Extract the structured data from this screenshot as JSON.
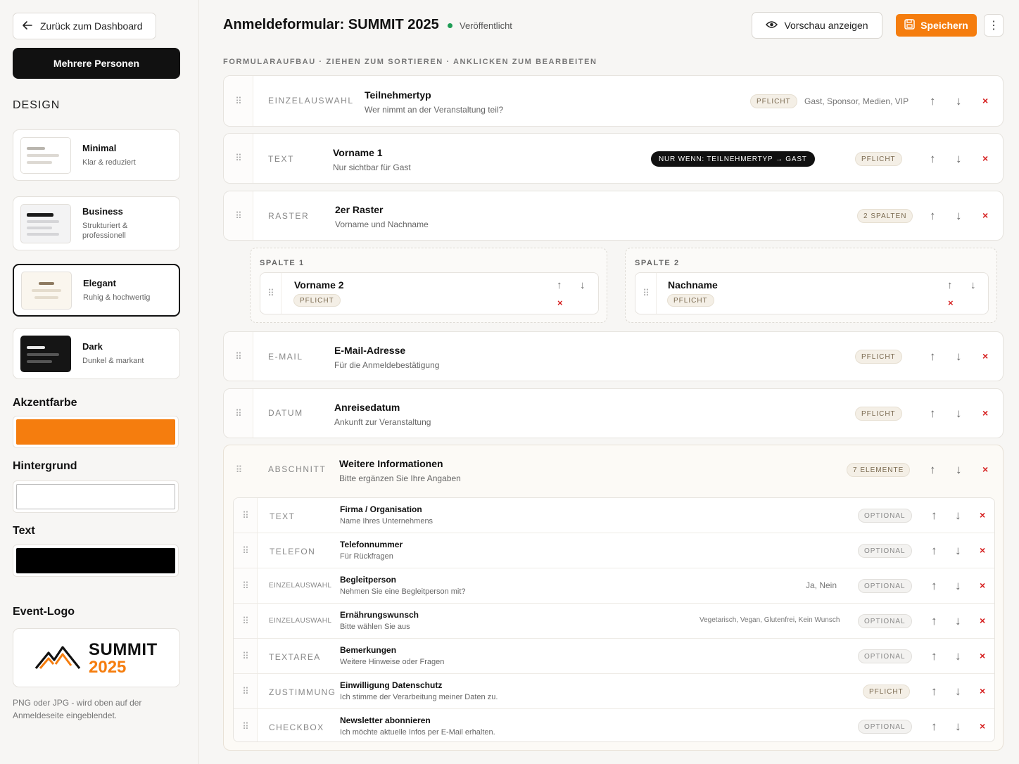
{
  "sidebar": {
    "back_label": "Zurück zum Dashboard",
    "multi_label": "Mehrere Personen",
    "design_heading": "DESIGN",
    "themes": [
      {
        "title": "Minimal",
        "subtitle": "Klar & reduziert"
      },
      {
        "title": "Business",
        "subtitle": "Strukturiert & professionell"
      },
      {
        "title": "Elegant",
        "subtitle": "Ruhig & hochwertig"
      },
      {
        "title": "Dark",
        "subtitle": "Dunkel & markant"
      }
    ],
    "selected_theme": "Elegant",
    "accent_label": "Akzentfarbe",
    "accent_color": "#f57d0e",
    "background_label": "Hintergrund",
    "background_color": "#ffffff",
    "text_label": "Text",
    "text_color": "#000000",
    "logo_label": "Event-Logo",
    "logo_line1": "SUMMIT",
    "logo_line2": "2025",
    "logo_note": "PNG oder JPG - wird oben auf der Anmeldeseite eingeblendet."
  },
  "header": {
    "title": "Anmeldeformular: SUMMIT 2025",
    "status": "Veröffentlicht",
    "status_color": "#1f9d55",
    "preview_label": "Vorschau anzeigen",
    "save_label": "Speichern"
  },
  "builder_hint": "FORMULARAUFBAU · ZIEHEN ZUM SORTIEREN · ANKLICKEN ZUM BEARBEITEN",
  "fields": [
    {
      "type": "EINZELAUSWAHL",
      "title": "Teilnehmertyp",
      "subtitle": "Wer nimmt an der Veranstaltung teil?",
      "badge": "PFLICHT",
      "options": "Gast, Sponsor, Medien, VIP"
    },
    {
      "type": "TEXT",
      "title": "Vorname 1",
      "subtitle": "Nur sichtbar für Gast",
      "condition": "NUR WENN: TEILNEHMERTYP → GAST",
      "badge": "PFLICHT"
    },
    {
      "type": "RASTER",
      "title": "2er Raster",
      "subtitle": "Vorname und Nachname",
      "badge": "2 SPALTEN"
    },
    {
      "type": "E-MAIL",
      "title": "E-Mail-Adresse",
      "subtitle": "Für die Anmeldebestätigung",
      "badge": "PFLICHT"
    },
    {
      "type": "DATUM",
      "title": "Anreisedatum",
      "subtitle": "Ankunft zur Veranstaltung",
      "badge": "PFLICHT"
    }
  ],
  "grid_columns": [
    {
      "label": "SPALTE 1",
      "field_title": "Vorname 2",
      "badge": "PFLICHT"
    },
    {
      "label": "SPALTE 2",
      "field_title": "Nachname",
      "badge": "PFLICHT"
    }
  ],
  "section": {
    "type": "ABSCHNITT",
    "title": "Weitere Informationen",
    "subtitle": "Bitte ergänzen Sie Ihre Angaben",
    "badge": "7 ELEMENTE",
    "items": [
      {
        "type": "TEXT",
        "title": "Firma / Organisation",
        "subtitle": "Name Ihres Unternehmens",
        "badge": "OPTIONAL",
        "options": ""
      },
      {
        "type": "TELEFON",
        "title": "Telefonnummer",
        "subtitle": "Für Rückfragen",
        "badge": "OPTIONAL",
        "options": ""
      },
      {
        "type": "EINZELAUSWAHL",
        "title": "Begleitperson",
        "subtitle": "Nehmen Sie eine Begleitperson mit?",
        "badge": "OPTIONAL",
        "options": "Ja, Nein"
      },
      {
        "type": "EINZELAUSWAHL",
        "title": "Ernährungswunsch",
        "subtitle": "Bitte wählen Sie aus",
        "badge": "OPTIONAL",
        "options": "Vegetarisch, Vegan, Glutenfrei, Kein Wunsch"
      },
      {
        "type": "TEXTAREA",
        "title": "Bemerkungen",
        "subtitle": "Weitere Hinweise oder Fragen",
        "badge": "OPTIONAL",
        "options": ""
      },
      {
        "type": "ZUSTIMMUNG",
        "title": "Einwilligung Datenschutz",
        "subtitle": "Ich stimme der Verarbeitung meiner Daten zu.",
        "badge": "PFLICHT",
        "options": ""
      },
      {
        "type": "CHECKBOX",
        "title": "Newsletter abonnieren",
        "subtitle": "Ich möchte aktuelle Infos per E-Mail erhalten.",
        "badge": "OPTIONAL",
        "options": ""
      }
    ]
  },
  "icons": {
    "grip": "⠿",
    "up": "↑",
    "down": "↓",
    "delete": "×",
    "more": "⋮"
  }
}
